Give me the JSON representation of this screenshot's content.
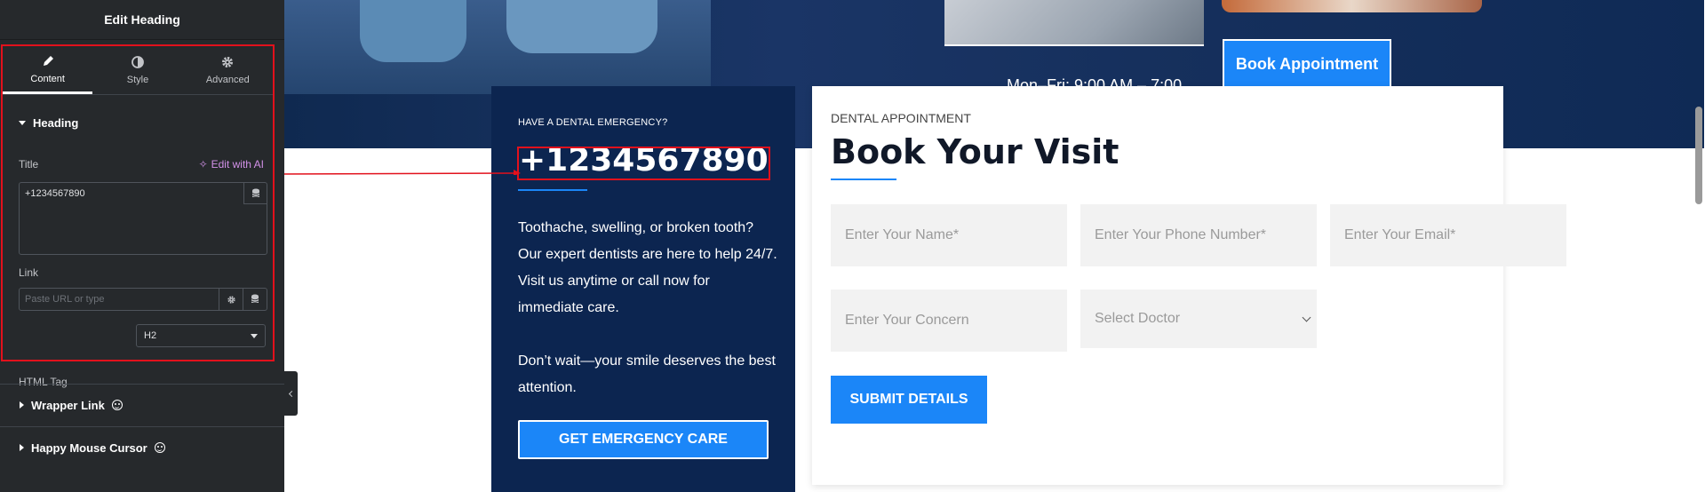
{
  "colors": {
    "panel_bg": "#26292c",
    "accent_blue": "#1b86f8",
    "navy": "#0c2550",
    "highlight_red": "#e2111c",
    "ai_pink": "#d291e8"
  },
  "editor": {
    "title": "Edit Heading",
    "tabs": [
      {
        "label": "Content",
        "icon": "pencil-icon",
        "active": true
      },
      {
        "label": "Style",
        "icon": "contrast-icon",
        "active": false
      },
      {
        "label": "Advanced",
        "icon": "gear-icon",
        "active": false
      }
    ],
    "section_title": "Heading",
    "title_label": "Title",
    "ai_link": "Edit with AI",
    "title_value": "+1234567890",
    "link_label": "Link",
    "link_placeholder": "Paste URL or type",
    "html_tag_label": "HTML Tag",
    "html_tag_value": "H2",
    "collapsed_sections": [
      "Wrapper Link",
      "Happy Mouse Cursor"
    ]
  },
  "hero": {
    "hours_text": "Mon–Fri: 9:00 AM – 7:00",
    "book_button": "Book Appointment"
  },
  "emergency": {
    "kicker": "HAVE A DENTAL EMERGENCY?",
    "phone": "+1234567890",
    "text1": "Toothache, swelling, or broken tooth? Our expert dentists are here to help 24/7. Visit us anytime or call now for immediate care.",
    "text2": "Don’t wait—your smile deserves the best attention.",
    "button": "GET EMERGENCY CARE"
  },
  "form": {
    "kicker": "DENTAL APPOINTMENT",
    "title": "Book Your Visit",
    "name_placeholder": "Enter Your Name*",
    "phone_placeholder": "Enter Your Phone Number*",
    "email_placeholder": "Enter Your Email*",
    "concern_placeholder": "Enter Your Concern",
    "doctor_select": "Select Doctor",
    "submit": "SUBMIT DETAILS"
  }
}
